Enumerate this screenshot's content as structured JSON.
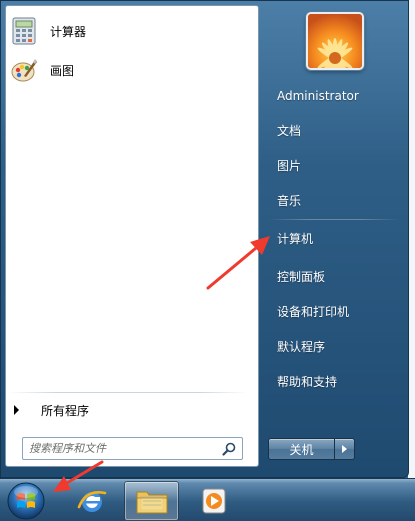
{
  "pinned_programs": [
    {
      "label": "计算器",
      "icon": "calculator-icon"
    },
    {
      "label": "画图",
      "icon": "paint-icon"
    }
  ],
  "all_programs_label": "所有程序",
  "search": {
    "placeholder": "搜索程序和文件",
    "icon": "search-icon"
  },
  "user": {
    "name": "Administrator",
    "avatar": "flower-avatar"
  },
  "right_items": [
    {
      "label": "文档"
    },
    {
      "label": "图片"
    },
    {
      "label": "音乐"
    },
    {
      "label": "计算机"
    },
    {
      "label": "控制面板"
    },
    {
      "label": "设备和打印机"
    },
    {
      "label": "默认程序"
    },
    {
      "label": "帮助和支持"
    }
  ],
  "shutdown": {
    "label": "关机",
    "arrow_icon": "triangle-right-icon"
  },
  "taskbar": {
    "items": [
      {
        "name": "start-orb",
        "icon": "windows-logo-icon"
      },
      {
        "name": "internet-explorer",
        "icon": "ie-icon"
      },
      {
        "name": "windows-explorer",
        "icon": "folder-icon",
        "active": true
      },
      {
        "name": "media-player",
        "icon": "media-player-icon"
      }
    ]
  },
  "colors": {
    "menu_blue": "#2e5e86",
    "annotation_red": "#f03a2e",
    "taskbar_blue": "#2f5b82"
  }
}
